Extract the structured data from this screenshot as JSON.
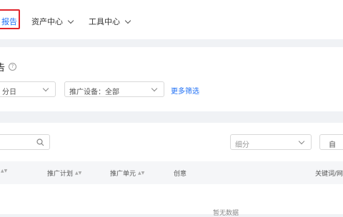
{
  "topnav": {
    "active_item": "报告",
    "items": [
      {
        "label": "资产中心"
      },
      {
        "label": "工具中心"
      }
    ]
  },
  "filters": {
    "title": "告",
    "help_symbol": "?",
    "date_select": "分日",
    "device_select": "推广设备：全部",
    "more_filters": "更多筛选"
  },
  "table_toolbar": {
    "search_placeholder": "",
    "granularity_placeholder": "细分",
    "right_button": "自"
  },
  "table": {
    "columns": [
      {
        "label": "",
        "sortable": true
      },
      {
        "label": "推广计划",
        "sortable": true
      },
      {
        "label": "推广单元",
        "sortable": true
      },
      {
        "label": "创意",
        "sortable": false
      },
      {
        "label": "关键词/网",
        "sortable": false
      }
    ],
    "empty_text": "暂无数据"
  },
  "colors": {
    "accent": "#1e6ff5",
    "highlight_border": "#e0242b",
    "background": "#f0f2f5"
  }
}
